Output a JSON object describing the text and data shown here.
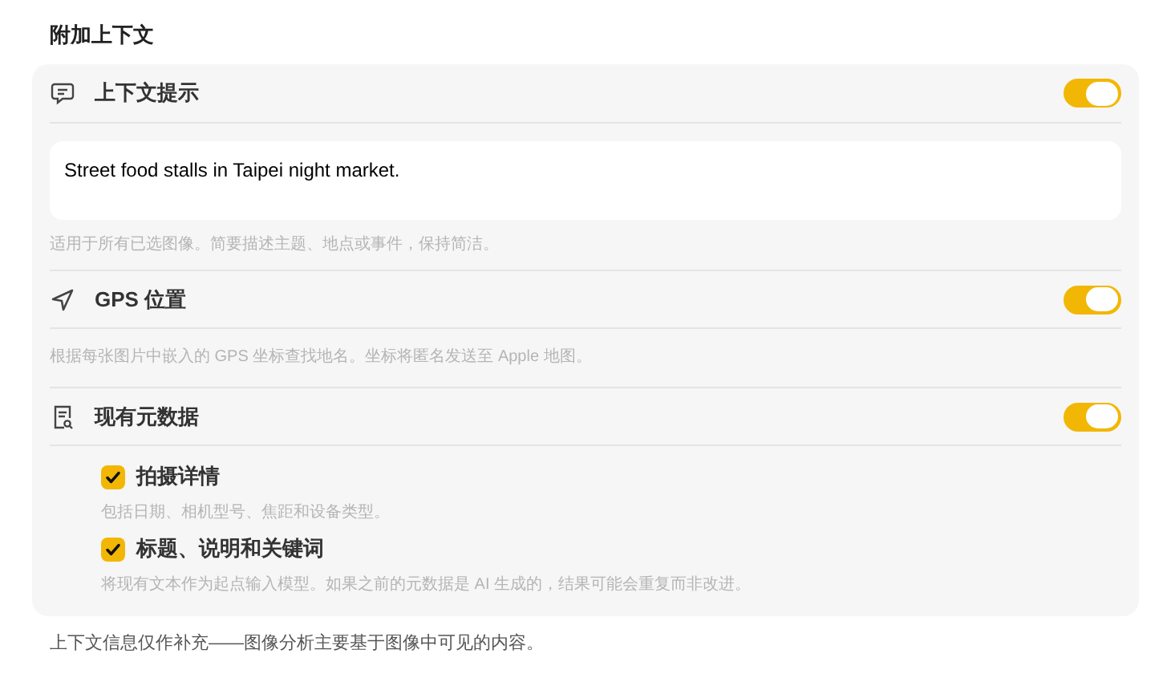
{
  "heading": "附加上下文",
  "sections": [
    {
      "kind": "text_input",
      "title": "上下文提示",
      "on": true,
      "value": "Street food stalls in Taipei night market.",
      "hint": "适用于所有已选图像。简要描述主题、地点或事件，保持简洁。"
    },
    {
      "kind": "plain",
      "title": "GPS 位置",
      "on": true,
      "hint": "根据每张图片中嵌入的 GPS 坐标查找地名。坐标将匿名发送至 Apple 地图。"
    },
    {
      "kind": "options",
      "title": "现有元数据",
      "on": true,
      "options": [
        {
          "label": "拍摄详情",
          "checked": true,
          "hint": "包括日期、相机型号、焦距和设备类型。"
        },
        {
          "label": "标题、说明和关键词",
          "checked": true,
          "hint": "将现有文本作为起点输入模型。如果之前的元数据是 AI 生成的，结果可能会重复而非改进。"
        }
      ]
    }
  ],
  "footer": "上下文信息仅作补充——图像分析主要基于图像中可见的内容。"
}
